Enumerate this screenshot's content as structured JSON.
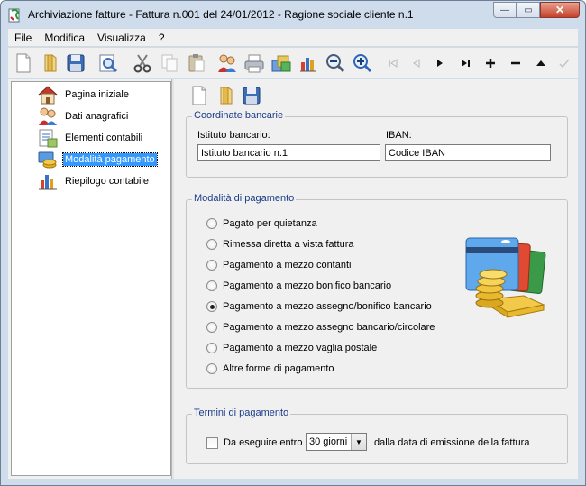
{
  "window": {
    "title": "Archiviazione fatture  -  Fattura n.001 del 24/01/2012  -  Ragione sociale cliente n.1",
    "minimize_glyph": "—",
    "maximize_glyph": "▭",
    "close_glyph": "✕"
  },
  "menu": [
    "File",
    "Modifica",
    "Visualizza",
    "?"
  ],
  "toolbar": {
    "icons": [
      "new-doc-icon",
      "open-folder-icon",
      "save-icon",
      "print-preview-icon",
      "cut-icon",
      "copy-icon",
      "paste-icon",
      "clients-icon",
      "print-icon",
      "invoices-icon",
      "chart-icon",
      "zoom-out-icon",
      "zoom-in-icon",
      "first-record-icon",
      "previous-record-icon",
      "next-record-icon",
      "last-record-icon",
      "add-record-icon",
      "remove-record-icon",
      "move-up-icon",
      "confirm-icon"
    ]
  },
  "sidebar": {
    "items": [
      {
        "label": "Pagina iniziale",
        "icon": "home-icon",
        "selected": false
      },
      {
        "label": "Dati anagrafici",
        "icon": "people-icon",
        "selected": false
      },
      {
        "label": "Elementi contabili",
        "icon": "ledger-icon",
        "selected": false
      },
      {
        "label": "Modalità pagamento",
        "icon": "payment-icon",
        "selected": true
      },
      {
        "label": "Riepilogo contabile",
        "icon": "summary-chart-icon",
        "selected": false
      }
    ]
  },
  "bank": {
    "legend": "Coordinate bancarie",
    "institute_label": "Istituto bancario:",
    "institute_value": "Istituto bancario n.1",
    "iban_label": "IBAN:",
    "iban_value": "Codice IBAN"
  },
  "payment": {
    "legend": "Modalità di pagamento",
    "options": [
      {
        "label": "Pagato per quietanza",
        "checked": false
      },
      {
        "label": "Rimessa diretta a vista fattura",
        "checked": false
      },
      {
        "label": "Pagamento a mezzo contanti",
        "checked": false
      },
      {
        "label": "Pagamento a mezzo bonifico bancario",
        "checked": false
      },
      {
        "label": "Pagamento a mezzo assegno/bonifico bancario",
        "checked": true
      },
      {
        "label": "Pagamento a mezzo assegno bancario/circolare",
        "checked": false
      },
      {
        "label": "Pagamento a mezzo vaglia postale",
        "checked": false
      },
      {
        "label": "Altre forme di pagamento",
        "checked": false
      }
    ]
  },
  "terms": {
    "legend": "Termini di pagamento",
    "checkbox_label": "Da eseguire entro",
    "checked": false,
    "days_value": "30 giorni",
    "suffix": "dalla data di emissione della fattura"
  },
  "colors": {
    "accent": "#3399ff",
    "legend_text": "#1c3c8a",
    "window_frame": "#cfdcec"
  }
}
